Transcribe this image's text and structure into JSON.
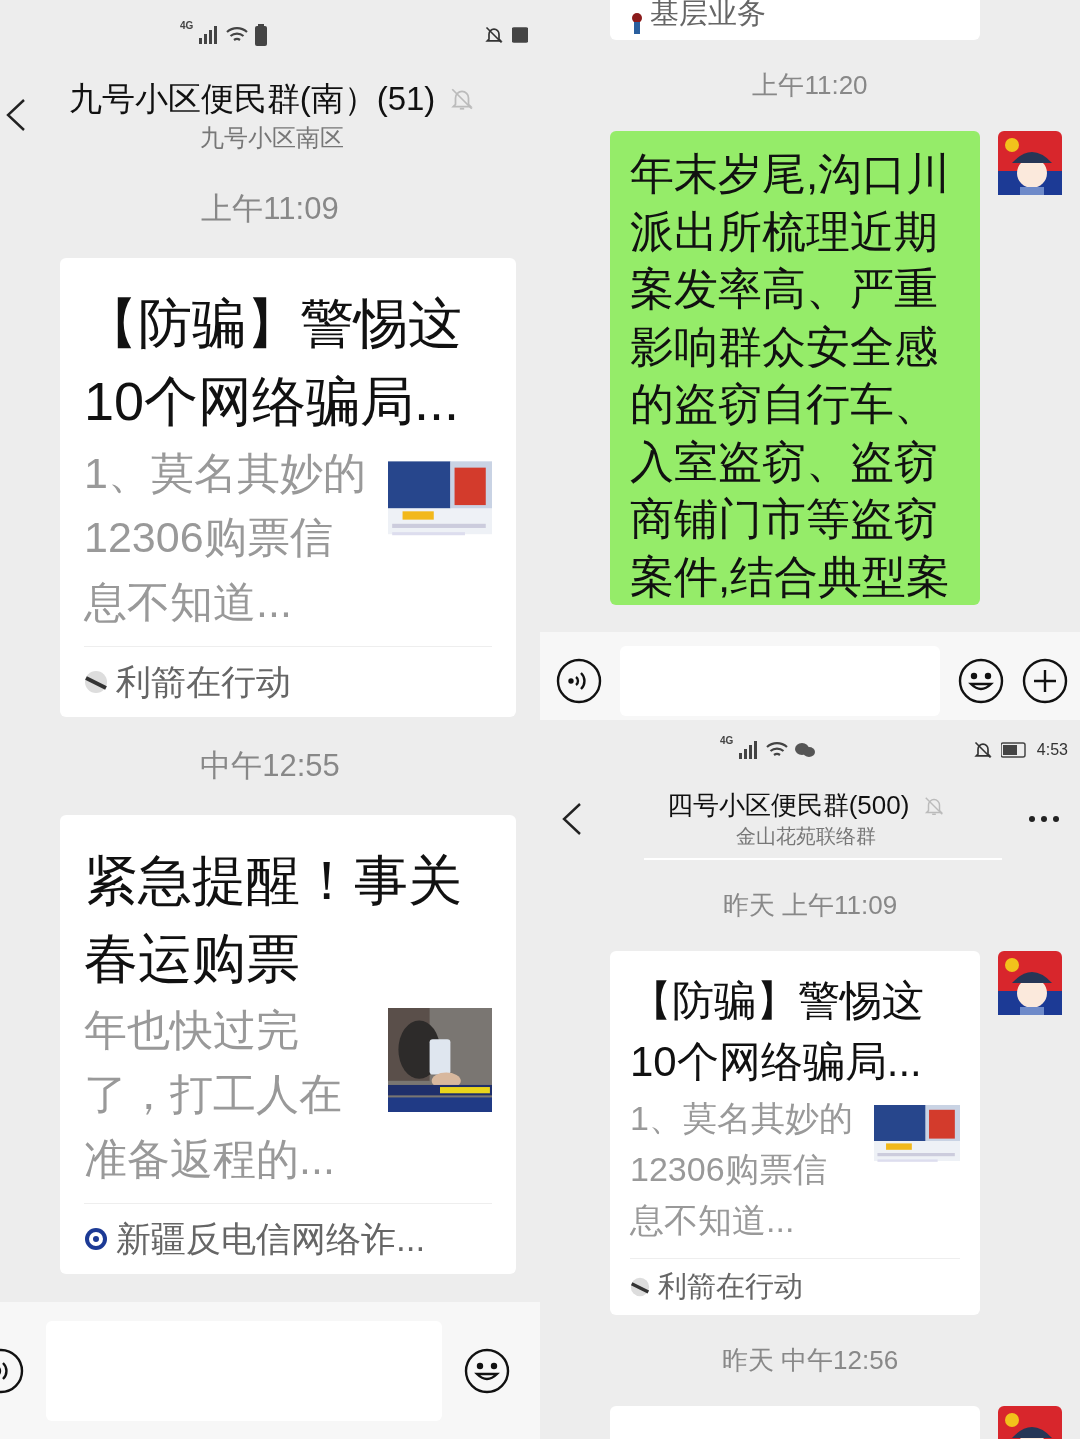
{
  "left_chat": {
    "status_bar": {
      "network": "4G"
    },
    "header": {
      "title": "九号小区便民群(南）(51)",
      "subtitle": "九号小区南区",
      "muted": true
    },
    "messages": [
      {
        "kind": "time",
        "text": "上午11:09"
      },
      {
        "kind": "link_card",
        "title": "【防骗】警惕这10个网络骗局...",
        "description": "1、莫名其妙的12306购票信息不知道...",
        "source": "利箭在行动"
      },
      {
        "kind": "time",
        "text": "中午12:55"
      },
      {
        "kind": "link_card",
        "title": "紧急提醒！事关春运购票",
        "description": "年也快过完了，打工人在准备返程的...",
        "source": "新疆反电信网络诈..."
      }
    ]
  },
  "right_top_chat": {
    "messages": [
      {
        "kind": "card_tail",
        "source": "基层业务"
      },
      {
        "kind": "time",
        "text": "上午11:20"
      },
      {
        "kind": "text",
        "text": "年末岁尾,沟口川派出所梳理近期案发率高、严重影响群众安全感的盗窃自行车、入室盗窃、盗窃商铺门市等盗窃案件,结合典型案"
      }
    ]
  },
  "right_bottom_chat": {
    "status_bar": {
      "network": "4G",
      "time": "4:53"
    },
    "header": {
      "title": "四号小区便民群(500)",
      "subtitle": "金山花苑联络群",
      "muted": true
    },
    "messages": [
      {
        "kind": "time",
        "text": "昨天 上午11:09"
      },
      {
        "kind": "link_card",
        "title": "【防骗】警惕这10个网络骗局...",
        "description": "1、莫名其妙的12306购票信息不知道...",
        "source": "利箭在行动"
      },
      {
        "kind": "time",
        "text": "昨天 中午12:56"
      },
      {
        "kind": "card_top"
      }
    ]
  }
}
